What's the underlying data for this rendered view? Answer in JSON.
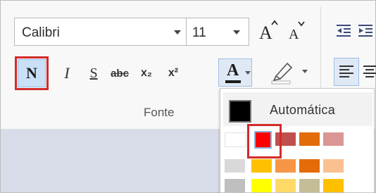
{
  "font_group": {
    "font_name": "Calibri",
    "font_size": "11",
    "group_label": "Fonte",
    "grow_font_icon": "grow-font-icon",
    "shrink_font_icon": "shrink-font-icon",
    "bold_label": "N",
    "italic_label": "I",
    "underline_label": "S",
    "strikethrough_label": "abc",
    "subscript_label": "x₂",
    "superscript_label": "x²",
    "font_color_label": "A",
    "font_color_value": "#ff0000",
    "highlight_color_value": "#ffffff",
    "bold_selected": true
  },
  "color_picker": {
    "automatic_label": "Automática",
    "automatic_color": "#000000",
    "selected_color": "#ff0000",
    "rows": [
      [
        "#ffffff",
        "#ff0000",
        "#c0504d",
        "#e26b0a",
        "#d99694"
      ],
      [
        "#d9d9d9",
        "#ffc000",
        "#f79646",
        "#e36c09",
        "#fac090"
      ],
      [
        "#bfbfbf",
        "#ffff00",
        "#ffd966",
        "#c4bd97",
        "#ffc000"
      ]
    ]
  },
  "colors": {
    "highlight_red": "#d42a2a",
    "document_bg": "#d8dce8"
  }
}
